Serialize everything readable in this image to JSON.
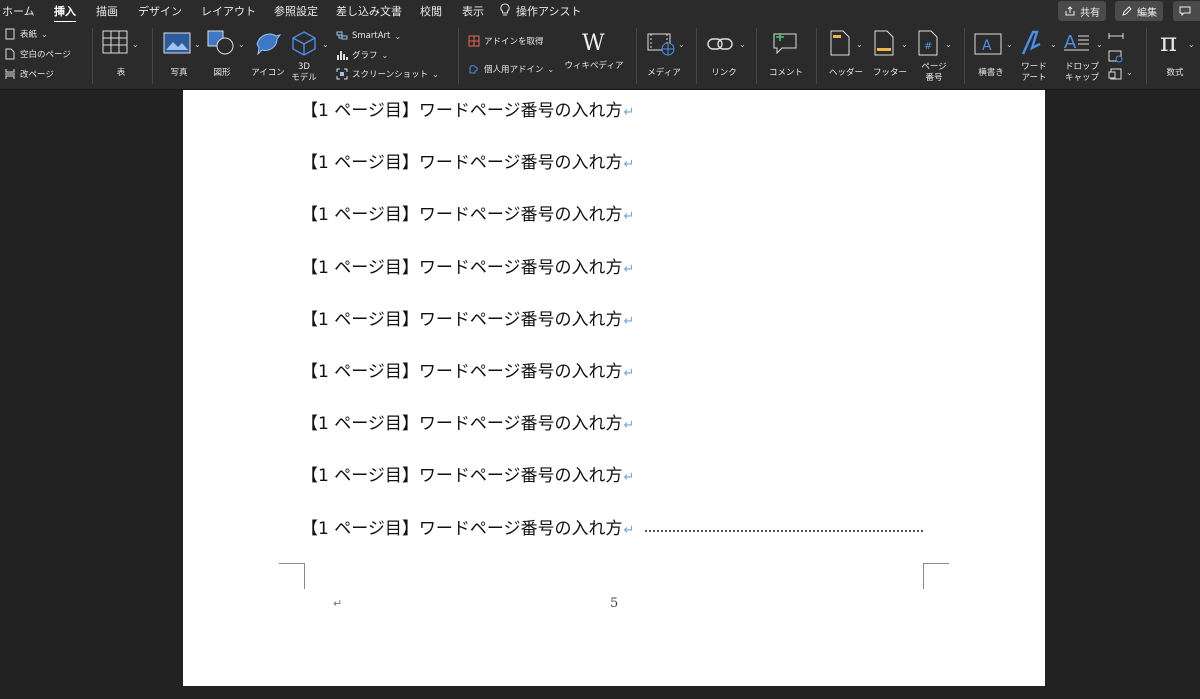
{
  "tabs": [
    "ホーム",
    "挿入",
    "描画",
    "デザイン",
    "レイアウト",
    "参照設定",
    "差し込み文書",
    "校閲",
    "表示"
  ],
  "assist_label": "操作アシスト",
  "share_label": "共有",
  "edit_label": "編集",
  "ribbon": {
    "pages": {
      "cover": "表紙",
      "blank": "空白のページ",
      "break": "改ページ"
    },
    "table": "表",
    "photo": "写真",
    "shape": "図形",
    "icons": "アイコン",
    "model3d_line1": "3D",
    "model3d_line2": "モデル",
    "smartart": "SmartArt",
    "graph": "グラフ",
    "screenshot": "スクリーンショット",
    "get_addin": "アドインを取得",
    "my_addin": "個人用アドイン",
    "wikipedia": "ウィキペディア",
    "media": "メディア",
    "link": "リンク",
    "comment": "コメント",
    "header": "ヘッダー",
    "footer": "フッター",
    "page_number_line1": "ページ",
    "page_number_line2": "番号",
    "textbox": "横書き",
    "wordart_line1": "ワード",
    "wordart_line2": "アート",
    "dropcap_line1": "ドロップ",
    "dropcap_line2": "キャップ",
    "equation": "数式"
  },
  "document": {
    "lines": [
      "【1 ページ目】ワードページ番号の入れ方",
      "【1 ページ目】ワードページ番号の入れ方",
      "【1 ページ目】ワードページ番号の入れ方",
      "【1 ページ目】ワードページ番号の入れ方",
      "【1 ページ目】ワードページ番号の入れ方",
      "【1 ページ目】ワードページ番号の入れ方",
      "【1 ページ目】ワードページ番号の入れ方",
      "【1 ページ目】ワードページ番号の入れ方",
      "【1 ページ目】ワードページ番号の入れ方"
    ],
    "return_mark": "↵",
    "page_number": "5"
  },
  "colors": {
    "accent_blue": "#4a8fe7",
    "ribbon_bg": "#2b2b2b",
    "page_bg": "#ffffff"
  }
}
